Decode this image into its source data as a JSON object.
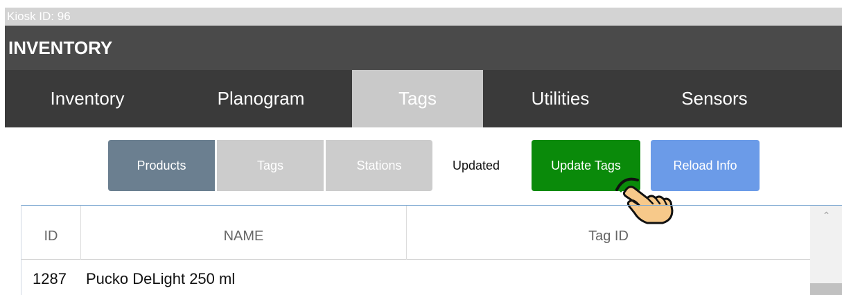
{
  "header": {
    "kiosk_label": "Kiosk ID: 96",
    "title": "INVENTORY"
  },
  "tabs": [
    {
      "label": "Inventory",
      "active": false
    },
    {
      "label": "Planogram",
      "active": false
    },
    {
      "label": "Tags",
      "active": true
    },
    {
      "label": "Utilities",
      "active": false
    },
    {
      "label": "Sensors",
      "active": false
    }
  ],
  "subnav": {
    "products_label": "Products",
    "tags_label": "Tags",
    "stations_label": "Stations",
    "status_text": "Updated",
    "update_tags_label": "Update Tags",
    "reload_info_label": "Reload Info"
  },
  "table": {
    "columns": [
      "ID",
      "NAME",
      "Tag ID"
    ],
    "rows": [
      {
        "id": "1287",
        "name": "Pucko DeLight 250 ml",
        "tag_id": ""
      }
    ]
  },
  "colors": {
    "products_active": "#6b7f90",
    "update_tags": "#0a8a0a",
    "reload_info": "#6b9be8",
    "title_bar": "#4a4a4a",
    "tabs_bar": "#3a3a3a"
  }
}
